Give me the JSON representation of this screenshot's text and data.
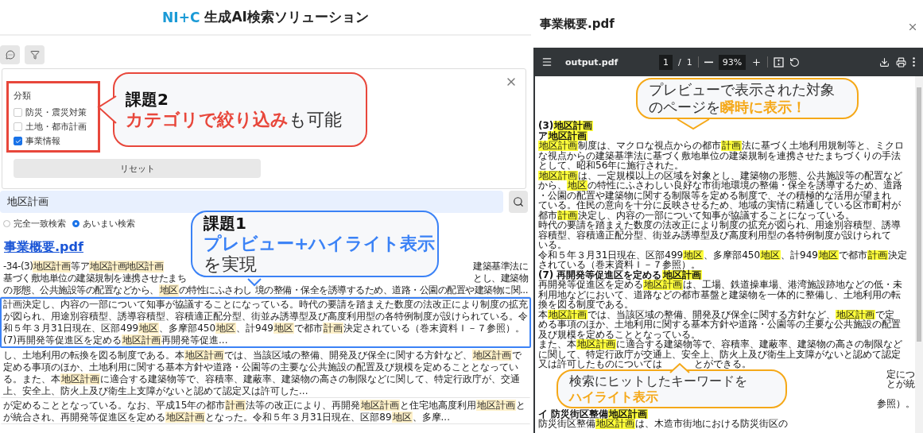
{
  "header": {
    "brand": "NI+C",
    "title": "生成AI検索ソリューション"
  },
  "filter": {
    "label": "分類",
    "options": [
      {
        "label": "防災・震災対策",
        "checked": false
      },
      {
        "label": "土地・都市計画",
        "checked": false
      },
      {
        "label": "事業情報",
        "checked": true
      }
    ],
    "reset": "リセット"
  },
  "search": {
    "value": "地区計画",
    "modes": [
      {
        "label": "完全一致検索",
        "selected": false
      },
      {
        "label": "あいまい検索",
        "selected": true
      }
    ]
  },
  "results": {
    "file": "事業概要.pdf",
    "snippets": [
      {
        "selected": false,
        "kind": "fragments",
        "lines": [
          [
            [
              {
                "text": "-34-(3)",
                "highlighted": false
              },
              {
                "text": "地区計画",
                "highlighted": true
              },
              {
                "text": "等ア",
                "highlighted": false
              },
              {
                "text": "地区計画地区計画",
                "highlighted": true
              }
            ],
            [
              {
                "text": "建築基準法に",
                "highlighted": false
              }
            ]
          ],
          [
            [
              {
                "text": "基づく敷地単位の建築規制を連携させたまち",
                "highlighted": false
              }
            ],
            [
              {
                "text": "とし、建築物",
                "highlighted": false
              }
            ]
          ],
          [
            [
              {
                "text": "の形態、公共施設等の配置などから、",
                "highlighted": false
              },
              {
                "text": "地区",
                "highlighted": true
              },
              {
                "text": "の特性にふさわし",
                "highlighted": false
              }
            ],
            [
              {
                "text": "境の整備・保全を誘導するため、道路・公園の配置や建築物に関...",
                "highlighted": false
              }
            ]
          ]
        ]
      },
      {
        "selected": true,
        "kind": "paragraph",
        "parts": [
          {
            "text": "計画決定し、内容の一部について知事が協議することになっている。時代の要請を踏まえた数度の法改正により制度の拡充が図られ、用途別容積型、誘導容積型、容積適正配分型、街並み誘導型及び高度利用型の各特例制度が設けられている。令和５年３月31日現在、区部499",
            "highlighted": false
          },
          {
            "text": "地区",
            "highlighted": true
          },
          {
            "text": "、多摩部450",
            "highlighted": false
          },
          {
            "text": "地区",
            "highlighted": true
          },
          {
            "text": "、計949",
            "highlighted": false
          },
          {
            "text": "地区",
            "highlighted": true
          },
          {
            "text": "で都市",
            "highlighted": false
          },
          {
            "text": "計画",
            "highlighted": true
          },
          {
            "text": "決定されている（巻末資料Ｉ－７参照）。(7)再開発等促進区を定める",
            "highlighted": false
          },
          {
            "text": "地区計画",
            "highlighted": true
          },
          {
            "text": "再開発等促進...",
            "highlighted": false
          }
        ]
      },
      {
        "selected": false,
        "kind": "paragraph",
        "parts": [
          {
            "text": "し、土地利用の転換を図る制度である。本",
            "highlighted": false
          },
          {
            "text": "地区計画",
            "highlighted": true
          },
          {
            "text": "では、当該区域の整備、開発及び保全に関する方針など、",
            "highlighted": false
          },
          {
            "text": "地区計画",
            "highlighted": true
          },
          {
            "text": "で定める事項のほか、土地利用に関する基本方針や道路・公園等の主要な公共施設の配置及び規模を定めることとなっている。また、本",
            "highlighted": false
          },
          {
            "text": "地区計画",
            "highlighted": true
          },
          {
            "text": "に適合する建築物等で、容積率、建蔽率、建築物の高さの制限などに関して、特定行政庁が、交通上、安全上、防火上及び衛生上支障がないと認めて認定又は許可した...",
            "highlighted": false
          }
        ]
      },
      {
        "selected": false,
        "kind": "paragraph",
        "parts": [
          {
            "text": "が定めることとなっている。なお、平成15年の都市",
            "highlighted": false
          },
          {
            "text": "計画",
            "highlighted": true
          },
          {
            "text": "法等の改正により、再開発",
            "highlighted": false
          },
          {
            "text": "地区計画",
            "highlighted": true
          },
          {
            "text": "と住宅地高度利用",
            "highlighted": false
          },
          {
            "text": "地区計画",
            "highlighted": true
          },
          {
            "text": "とが統合され、再開発等促進区を定める",
            "highlighted": false
          },
          {
            "text": "地区計画",
            "highlighted": true
          },
          {
            "text": "となった。令和５年３月31日現在、区部89",
            "highlighted": false
          },
          {
            "text": "地区",
            "highlighted": true
          },
          {
            "text": "、多摩...",
            "highlighted": false
          }
        ]
      }
    ]
  },
  "preview": {
    "title": "事業概要.pdf",
    "viewer": {
      "file": "output.pdf",
      "page": "1",
      "separator": "/",
      "total": "1",
      "zoom": "93%"
    },
    "lines": [
      {
        "kind": "heading",
        "pieces": [
          [
            {
              "text": "(3) ",
              "highlighted": false
            },
            {
              "text": "地区計画",
              "highlighted": true
            }
          ]
        ]
      },
      {
        "kind": "heading",
        "pieces": [
          [
            {
              "text": "ア ",
              "highlighted": false
            },
            {
              "text": "地区計画",
              "highlighted": true
            }
          ]
        ]
      },
      {
        "kind": "text",
        "pieces": [
          [
            {
              "text": "地区計画",
              "highlighted": true
            },
            {
              "text": "制度は、マクロな視点からの都市",
              "highlighted": false
            },
            {
              "text": "計画",
              "highlighted": true
            },
            {
              "text": "法に基づく土地利用規制等と、ミクロ",
              "highlighted": false
            }
          ]
        ]
      },
      {
        "kind": "text",
        "pieces": [
          [
            {
              "text": "な視点からの建築基準法に基づく敷地単位の建築規制を連携させたまちづくりの手法",
              "highlighted": false
            }
          ]
        ]
      },
      {
        "kind": "text",
        "pieces": [
          [
            {
              "text": "として、昭和56年に施行された。",
              "highlighted": false
            }
          ]
        ]
      },
      {
        "kind": "text",
        "pieces": [
          [
            {
              "text": "地区計画",
              "highlighted": true
            },
            {
              "text": "は、一定規模以上の区域を対象とし、建築物の形態、公共施設等の配置など",
              "highlighted": false
            }
          ]
        ]
      },
      {
        "kind": "text",
        "pieces": [
          [
            {
              "text": "から、",
              "highlighted": false
            },
            {
              "text": "地区",
              "highlighted": true
            },
            {
              "text": "の特性にふさわしい良好な市街地環境の整備・保全を誘導するため、道路",
              "highlighted": false
            }
          ]
        ]
      },
      {
        "kind": "text",
        "pieces": [
          [
            {
              "text": "・公園の配置や建築物に関する制限等を定める制度で、その積極的な活用が望まれ",
              "highlighted": false
            }
          ]
        ]
      },
      {
        "kind": "text",
        "pieces": [
          [
            {
              "text": "ている。住民の意向を十分に反映させるため、地域の実情に精通している区市町村が",
              "highlighted": false
            }
          ]
        ]
      },
      {
        "kind": "text",
        "pieces": [
          [
            {
              "text": "都市",
              "highlighted": false
            },
            {
              "text": "計画",
              "highlighted": true
            },
            {
              "text": "決定し、内容の一部について知事が協議することになっている。",
              "highlighted": false
            }
          ]
        ]
      },
      {
        "kind": "text",
        "pieces": [
          [
            {
              "text": "時代の要請を踏まえた数度の法改正により制度の拡充が図られ、用途別容積型、誘導",
              "highlighted": false
            }
          ]
        ]
      },
      {
        "kind": "text",
        "pieces": [
          [
            {
              "text": "容積型、容積適正配分型、街並み誘導型及び高度利用型の各特例制度が設けられて",
              "highlighted": false
            }
          ]
        ]
      },
      {
        "kind": "text",
        "pieces": [
          [
            {
              "text": "いる。",
              "highlighted": false
            }
          ]
        ]
      },
      {
        "kind": "text",
        "pieces": [
          [
            {
              "text": "令和５年３月31日現在、区部499",
              "highlighted": false
            },
            {
              "text": "地区",
              "highlighted": true
            },
            {
              "text": "、多摩部450",
              "highlighted": false
            },
            {
              "text": "地区",
              "highlighted": true
            },
            {
              "text": "、計949",
              "highlighted": false
            },
            {
              "text": "地区",
              "highlighted": true
            },
            {
              "text": "で都市",
              "highlighted": false
            },
            {
              "text": "計画",
              "highlighted": true
            },
            {
              "text": "決定",
              "highlighted": false
            }
          ]
        ]
      },
      {
        "kind": "text",
        "pieces": [
          [
            {
              "text": "されている（巻末資料Ｉ－７参照）。",
              "highlighted": false
            }
          ]
        ]
      },
      {
        "kind": "heading",
        "pieces": [
          [
            {
              "text": "(7) 再開発等促進区を定める",
              "highlighted": false
            },
            {
              "text": "地区計画",
              "highlighted": true
            }
          ]
        ]
      },
      {
        "kind": "text",
        "pieces": [
          [
            {
              "text": "再開発等促進区を定める",
              "highlighted": false
            },
            {
              "text": "地区計画",
              "highlighted": true
            },
            {
              "text": "は、工場、鉄道操車場、港湾施設跡地などの低・未",
              "highlighted": false
            }
          ]
        ]
      },
      {
        "kind": "text",
        "pieces": [
          [
            {
              "text": "利用地などにおいて、道路などの都市基盤と建築物を一体的に整備し、土地利用の転",
              "highlighted": false
            }
          ]
        ]
      },
      {
        "kind": "text",
        "pieces": [
          [
            {
              "text": "換を図る制度である。",
              "highlighted": false
            }
          ]
        ]
      },
      {
        "kind": "text",
        "pieces": [
          [
            {
              "text": "本",
              "highlighted": false
            },
            {
              "text": "地区計画",
              "highlighted": true
            },
            {
              "text": "では、当該区域の整備、開発及び保全に関する方針など、",
              "highlighted": false
            },
            {
              "text": "地区計画",
              "highlighted": true
            },
            {
              "text": "で定",
              "highlighted": false
            }
          ]
        ]
      },
      {
        "kind": "text",
        "pieces": [
          [
            {
              "text": "める事項のほか、土地利用に関する基本方針や道路・公園等の主要な公共施設の配置",
              "highlighted": false
            }
          ]
        ]
      },
      {
        "kind": "text",
        "pieces": [
          [
            {
              "text": "及び規模を定めることとなっている。",
              "highlighted": false
            }
          ]
        ]
      },
      {
        "kind": "text",
        "pieces": [
          [
            {
              "text": "また、本",
              "highlighted": false
            },
            {
              "text": "地区計画",
              "highlighted": true
            },
            {
              "text": "に適合する建築物等で、容積率、建蔽率、建築物の高さの制限など",
              "highlighted": false
            }
          ]
        ]
      },
      {
        "kind": "text",
        "pieces": [
          [
            {
              "text": "に関して、特定行政庁が交通上、安全上、防火上及び衛生上支障がないと認めて認定",
              "highlighted": false
            }
          ]
        ]
      },
      {
        "kind": "text",
        "pieces": [
          [
            {
              "text": "又は許可したものについては",
              "highlighted": false
            }
          ],
          [
            {
              "text": "とができる。",
              "highlighted": false
            }
          ]
        ]
      },
      {
        "kind": "fragment",
        "pieces": [
          [
            {
              "text": "定につ",
              "highlighted": false
            }
          ]
        ]
      },
      {
        "kind": "fragment",
        "pieces": [
          [
            {
              "text": "とが統",
              "highlighted": false
            }
          ]
        ]
      },
      {
        "kind": "blank"
      },
      {
        "kind": "fragment",
        "pieces": [
          [
            {
              "text": "参照）。",
              "highlighted": false
            }
          ]
        ]
      },
      {
        "kind": "heading",
        "pieces": [
          [
            {
              "text": "イ 防災街区整備",
              "highlighted": false
            },
            {
              "text": "地区計画",
              "highlighted": true
            }
          ]
        ]
      },
      {
        "kind": "text",
        "pieces": [
          [
            {
              "text": "防災街区整備",
              "highlighted": false
            },
            {
              "text": "地区計画",
              "highlighted": true
            },
            {
              "text": "は、木造市街地における防災街区の",
              "highlighted": false
            }
          ]
        ]
      }
    ]
  },
  "callouts": [
    {
      "heading": "課題2",
      "color": "#e8473b",
      "lines": [
        [
          {
            "text": "カテゴリで絞り込み",
            "emphasis": true
          },
          {
            "text": "も可能",
            "emphasis": false
          }
        ]
      ]
    },
    {
      "heading": "課題1",
      "color": "#3b82f6",
      "lines": [
        [
          {
            "text": "プレビュー+ハイライト表示",
            "emphasis": true
          }
        ],
        [
          {
            "text": "を実現",
            "emphasis": false
          }
        ]
      ]
    },
    {
      "color": "#f5a818",
      "lines": [
        [
          {
            "text": "プレビューで表示された対象",
            "emphasis": false
          }
        ],
        [
          {
            "text": "のページを",
            "emphasis": false
          },
          {
            "text": "瞬時に表示！",
            "emphasis": true
          }
        ]
      ]
    },
    {
      "color": "#f5a818",
      "lines": [
        [
          {
            "text": "検索にヒットしたキーワードを",
            "emphasis": false
          }
        ],
        [
          {
            "text": "ハイライト表示",
            "emphasis": true
          }
        ]
      ]
    }
  ]
}
